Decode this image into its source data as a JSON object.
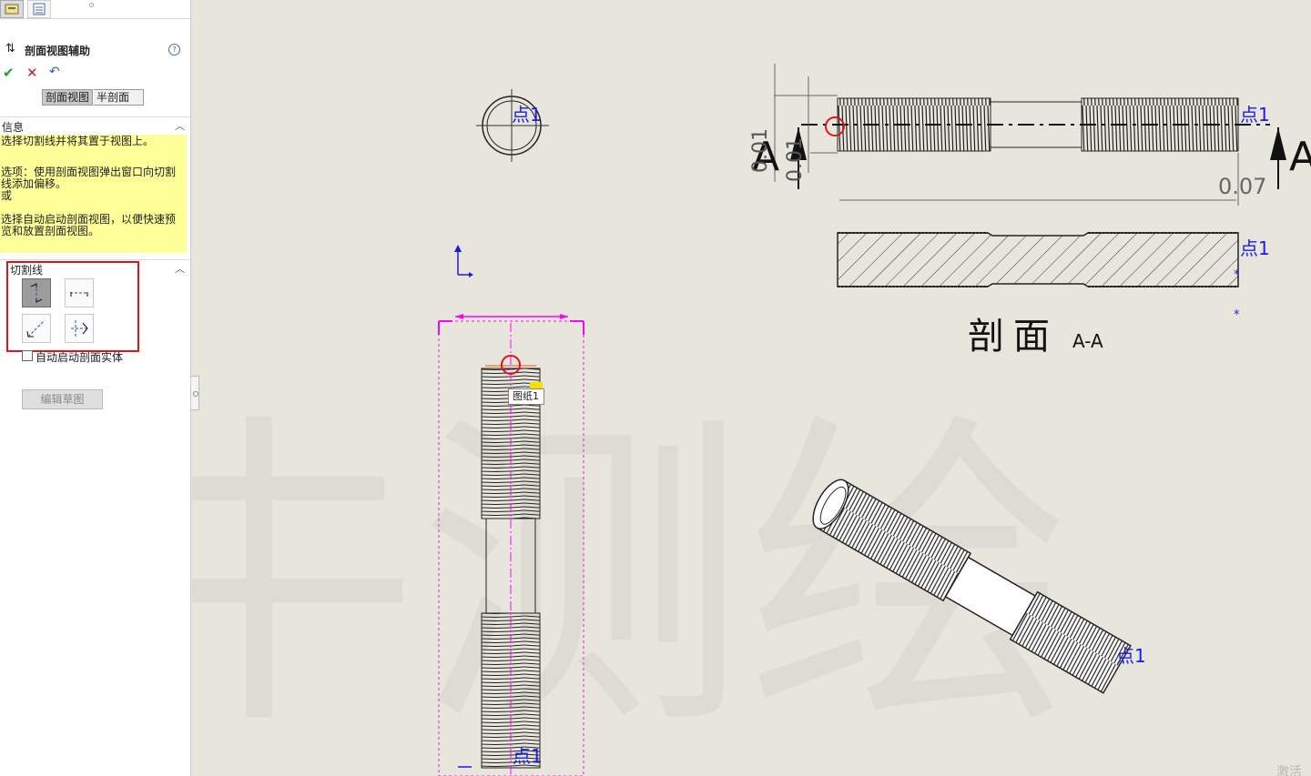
{
  "property_manager": {
    "title": "剖面视图辅助",
    "segments": [
      "剖面视图",
      "半剖面"
    ],
    "info_header": "信息",
    "info_lines": [
      "选择切割线并将其置于视图上。",
      "选项：使用剖面视图弹出窗口向切割线添加偏移。",
      "或",
      "选择自动启动剖面视图，以便快速预览和放置剖面视图。"
    ],
    "cutline_header": "切割线",
    "checkbox_label": "自动启动剖面实体",
    "edit_sketch_label": "编辑草图"
  },
  "drawing": {
    "point_label": "点1",
    "tooltip": "图纸1",
    "section_letter": "A",
    "section_title": "剖面",
    "section_name": "A-A",
    "dim_small": "0.01",
    "dim_tol": "0.07",
    "watermark": "大水牛测绘",
    "corner_text": "激活"
  },
  "colors": {
    "sketch": "#ff00ff",
    "point": "#0000ff",
    "highlight": "#e0141c",
    "info_bg": "#ffff99"
  }
}
